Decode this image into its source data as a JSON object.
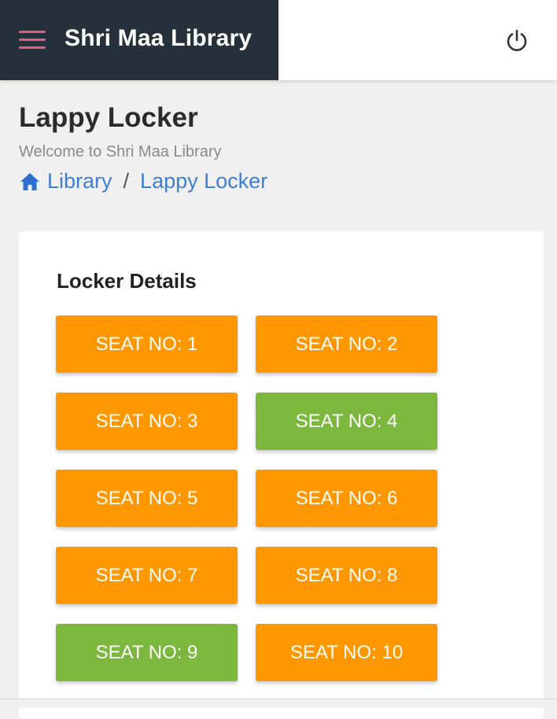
{
  "app": {
    "title": "Shri Maa Library"
  },
  "header": {
    "title": "Lappy Locker",
    "subtitle": "Welcome to Shri Maa Library",
    "breadcrumb": [
      {
        "label": "Library",
        "icon": "home-icon"
      },
      {
        "label": "Lappy Locker"
      }
    ],
    "breadcrumb_separator": "/"
  },
  "locker": {
    "title": "Locker Details",
    "seats": [
      {
        "label": "SEAT NO: 1",
        "status": "booked"
      },
      {
        "label": "SEAT NO: 2",
        "status": "booked"
      },
      {
        "label": "SEAT NO: 3",
        "status": "booked"
      },
      {
        "label": "SEAT NO: 4",
        "status": "free"
      },
      {
        "label": "SEAT NO: 5",
        "status": "booked"
      },
      {
        "label": "SEAT NO: 6",
        "status": "booked"
      },
      {
        "label": "SEAT NO: 7",
        "status": "booked"
      },
      {
        "label": "SEAT NO: 8",
        "status": "booked"
      },
      {
        "label": "SEAT NO: 9",
        "status": "free"
      },
      {
        "label": "SEAT NO: 10",
        "status": "booked"
      }
    ]
  },
  "colors": {
    "sidebar_bg": "#25303a",
    "menu_icon": "#e25d84",
    "booked": "#ff9800",
    "free": "#7cb83e",
    "link": "#3d7fd6"
  }
}
